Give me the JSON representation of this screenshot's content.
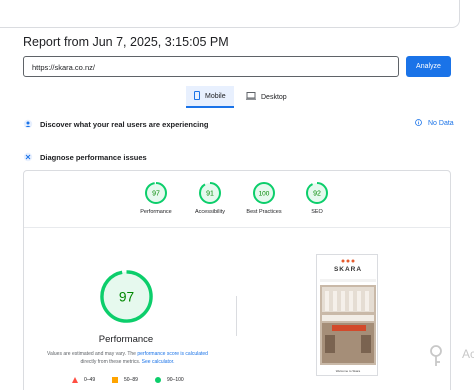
{
  "report": {
    "title": "Report from Jun 7, 2025, 3:15:05 PM",
    "url": "https://skara.co.nz/",
    "analyze_label": "Analyze"
  },
  "tabs": {
    "mobile": "Mobile",
    "desktop": "Desktop"
  },
  "discover": {
    "title": "Discover what your real users are experiencing",
    "nodata": "No Data"
  },
  "diagnose": {
    "title": "Diagnose performance issues"
  },
  "scores": [
    {
      "value": "97",
      "label": "Performance",
      "fraction": 0.97
    },
    {
      "value": "91",
      "label": "Accessibility",
      "fraction": 0.91
    },
    {
      "value": "100",
      "label": "Best Practices",
      "fraction": 1.0
    },
    {
      "value": "92",
      "label": "SEO",
      "fraction": 0.92
    }
  ],
  "performance": {
    "value": "97",
    "label": "Performance",
    "note_part1": "Values are estimated and may vary. The ",
    "note_link1": "performance score is calculated",
    "note_part2": " directly from these metrics. ",
    "note_link2": "See calculator."
  },
  "legend": {
    "bad": "0–49",
    "average": "50–89",
    "good": "90–100"
  },
  "screenshot": {
    "brand": "SKARA",
    "caption": "Welcome to Skara"
  },
  "colors": {
    "accent": "#1a73e8",
    "good": "#0cce6b",
    "average": "#ffa400",
    "bad": "#ff4e42"
  },
  "watermark": "Ac"
}
